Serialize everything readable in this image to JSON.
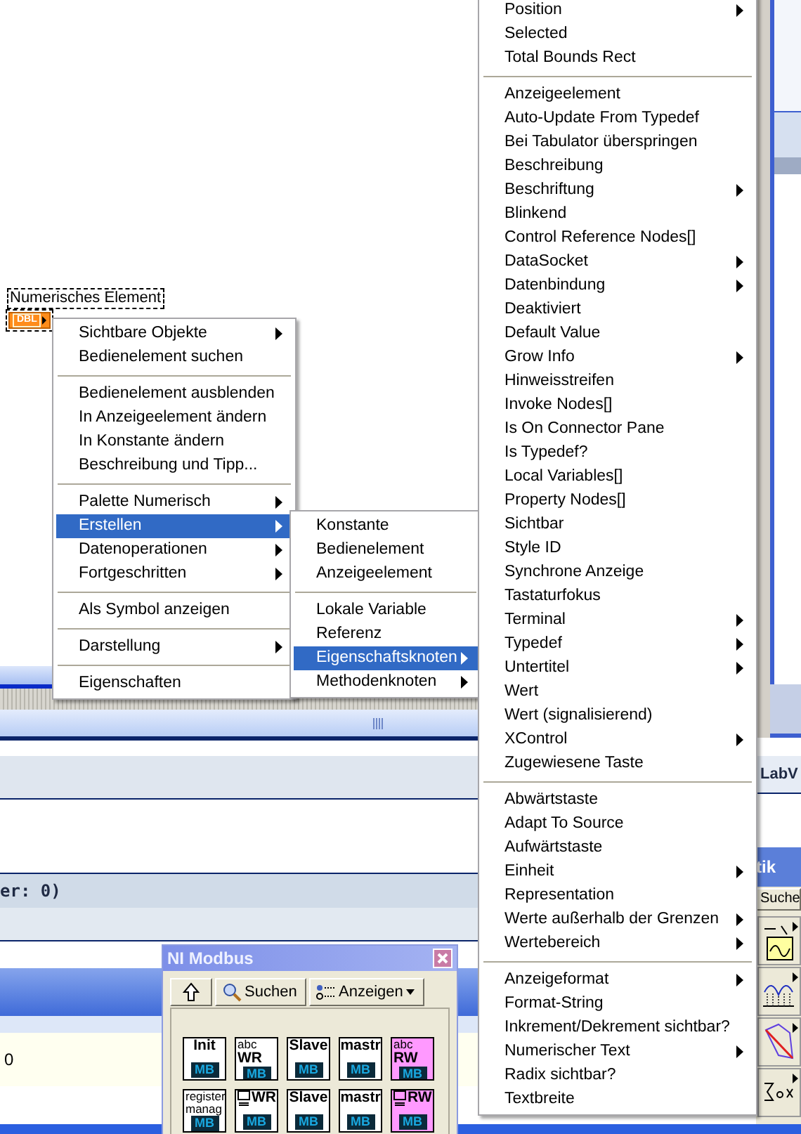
{
  "canvas": {
    "label": "Numerisches Element",
    "terminal": "DBL"
  },
  "context_menu": {
    "groups": [
      [
        {
          "label": "Sichtbare Objekte",
          "submenu": true,
          "selected": false
        },
        {
          "label": "Bedienelement suchen",
          "submenu": false,
          "selected": false
        }
      ],
      [
        {
          "label": "Bedienelement ausblenden",
          "submenu": false,
          "selected": false
        },
        {
          "label": "In Anzeigeelement ändern",
          "submenu": false,
          "selected": false
        },
        {
          "label": "In Konstante ändern",
          "submenu": false,
          "selected": false
        },
        {
          "label": "Beschreibung und Tipp...",
          "submenu": false,
          "selected": false
        }
      ],
      [
        {
          "label": "Palette Numerisch",
          "submenu": true,
          "selected": false
        },
        {
          "label": "Erstellen",
          "submenu": true,
          "selected": true
        },
        {
          "label": "Datenoperationen",
          "submenu": true,
          "selected": false
        },
        {
          "label": "Fortgeschritten",
          "submenu": true,
          "selected": false
        }
      ],
      [
        {
          "label": "Als Symbol anzeigen",
          "submenu": false,
          "selected": false
        }
      ],
      [
        {
          "label": "Darstellung",
          "submenu": true,
          "selected": false
        }
      ],
      [
        {
          "label": "Eigenschaften",
          "submenu": false,
          "selected": false
        }
      ]
    ]
  },
  "create_menu": {
    "groups": [
      [
        {
          "label": "Konstante",
          "submenu": false,
          "selected": false
        },
        {
          "label": "Bedienelement",
          "submenu": false,
          "selected": false
        },
        {
          "label": "Anzeigeelement",
          "submenu": false,
          "selected": false
        }
      ],
      [
        {
          "label": "Lokale Variable",
          "submenu": false,
          "selected": false
        },
        {
          "label": "Referenz",
          "submenu": false,
          "selected": false
        },
        {
          "label": "Eigenschaftsknoten",
          "submenu": true,
          "selected": true
        },
        {
          "label": "Methodenknoten",
          "submenu": true,
          "selected": false
        }
      ]
    ]
  },
  "property_menu": {
    "groups": [
      [
        {
          "label": "Position",
          "submenu": true,
          "selected": false
        },
        {
          "label": "Selected",
          "submenu": false,
          "selected": false
        },
        {
          "label": "Total Bounds Rect",
          "submenu": false,
          "selected": false
        }
      ],
      [
        {
          "label": "Anzeigeelement",
          "submenu": false,
          "selected": false
        },
        {
          "label": "Auto-Update From Typedef",
          "submenu": false,
          "selected": false
        },
        {
          "label": "Bei Tabulator überspringen",
          "submenu": false,
          "selected": false
        },
        {
          "label": "Beschreibung",
          "submenu": false,
          "selected": false
        },
        {
          "label": "Beschriftung",
          "submenu": true,
          "selected": false
        },
        {
          "label": "Blinkend",
          "submenu": false,
          "selected": false
        },
        {
          "label": "Control Reference Nodes[]",
          "submenu": false,
          "selected": false
        },
        {
          "label": "DataSocket",
          "submenu": true,
          "selected": false
        },
        {
          "label": "Datenbindung",
          "submenu": true,
          "selected": false
        },
        {
          "label": "Deaktiviert",
          "submenu": false,
          "selected": false
        },
        {
          "label": "Default Value",
          "submenu": false,
          "selected": false
        },
        {
          "label": "Grow Info",
          "submenu": true,
          "selected": false
        },
        {
          "label": "Hinweisstreifen",
          "submenu": false,
          "selected": false
        },
        {
          "label": "Invoke Nodes[]",
          "submenu": false,
          "selected": false
        },
        {
          "label": "Is On Connector Pane",
          "submenu": false,
          "selected": false
        },
        {
          "label": "Is Typedef?",
          "submenu": false,
          "selected": false
        },
        {
          "label": "Local Variables[]",
          "submenu": false,
          "selected": false
        },
        {
          "label": "Property Nodes[]",
          "submenu": false,
          "selected": false
        },
        {
          "label": "Sichtbar",
          "submenu": false,
          "selected": false
        },
        {
          "label": "Style ID",
          "submenu": false,
          "selected": false
        },
        {
          "label": "Synchrone Anzeige",
          "submenu": false,
          "selected": false
        },
        {
          "label": "Tastaturfokus",
          "submenu": false,
          "selected": false
        },
        {
          "label": "Terminal",
          "submenu": true,
          "selected": false
        },
        {
          "label": "Typedef",
          "submenu": true,
          "selected": false
        },
        {
          "label": "Untertitel",
          "submenu": true,
          "selected": false
        },
        {
          "label": "Wert",
          "submenu": false,
          "selected": false
        },
        {
          "label": "Wert (signalisierend)",
          "submenu": false,
          "selected": false
        },
        {
          "label": "XControl",
          "submenu": true,
          "selected": false
        },
        {
          "label": "Zugewiesene Taste",
          "submenu": false,
          "selected": false
        }
      ],
      [
        {
          "label": "Abwärtstaste",
          "submenu": false,
          "selected": false
        },
        {
          "label": "Adapt To Source",
          "submenu": false,
          "selected": false
        },
        {
          "label": "Aufwärtstaste",
          "submenu": false,
          "selected": false
        },
        {
          "label": "Einheit",
          "submenu": true,
          "selected": false
        },
        {
          "label": "Representation",
          "submenu": false,
          "selected": false
        },
        {
          "label": "Werte außerhalb der Grenzen",
          "submenu": true,
          "selected": false
        },
        {
          "label": "Wertebereich",
          "submenu": true,
          "selected": false
        }
      ],
      [
        {
          "label": "Anzeigeformat",
          "submenu": true,
          "selected": false
        },
        {
          "label": "Format-String",
          "submenu": false,
          "selected": false
        },
        {
          "label": "Inkrement/Dekrement sichtbar?",
          "submenu": false,
          "selected": false
        },
        {
          "label": "Numerischer Text",
          "submenu": true,
          "selected": false
        },
        {
          "label": "Radix sichtbar?",
          "submenu": false,
          "selected": false
        },
        {
          "label": "Textbreite",
          "submenu": false,
          "selected": false
        }
      ]
    ]
  },
  "background": {
    "status_text": "er: 0)",
    "value": "0",
    "side_title": "LabV"
  },
  "functions_palette": {
    "title": "tik",
    "search_label": "Suche",
    "tiles": [
      {
        "kind": "formula"
      },
      {
        "kind": "chart"
      },
      {
        "kind": "polygon"
      },
      {
        "kind": "sum"
      }
    ]
  },
  "palette_window": {
    "title": "NI Modbus",
    "buttons": [
      {
        "kind": "up"
      },
      {
        "kind": "search",
        "label": "Suchen"
      },
      {
        "kind": "view",
        "label": "Anzeigen"
      }
    ],
    "tiles": [
      {
        "kind": "label",
        "lines": [
          "Init"
        ],
        "badge": "MB",
        "color": "#ffffff"
      },
      {
        "kind": "abc",
        "lines": [
          "abc",
          "WR"
        ],
        "badge": "MB",
        "color": "#ffffff"
      },
      {
        "kind": "label",
        "lines": [
          "Slave"
        ],
        "badge": "MB",
        "color": "#ffffff"
      },
      {
        "kind": "label",
        "lines": [
          "mastr"
        ],
        "badge": "MB",
        "color": "#ffffff"
      },
      {
        "kind": "abc",
        "lines": [
          "abc",
          "RW"
        ],
        "badge": "MB",
        "color": "#ff99ff"
      },
      {
        "kind": "small",
        "lines": [
          "register",
          "manag"
        ],
        "badge": "MB",
        "color": "#ffffff"
      },
      {
        "kind": "computer",
        "lines": [
          "WR"
        ],
        "badge": "MB",
        "color": "#ffffff"
      },
      {
        "kind": "label",
        "lines": [
          "Slave"
        ],
        "badge": "MB",
        "color": "#ffffff"
      },
      {
        "kind": "label",
        "lines": [
          "mastr"
        ],
        "badge": "MB",
        "color": "#ffffff"
      },
      {
        "kind": "computer",
        "lines": [
          "RW"
        ],
        "badge": "MB",
        "color": "#ff99ff"
      }
    ]
  }
}
